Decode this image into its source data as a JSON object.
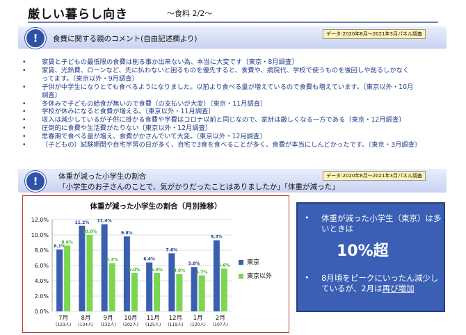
{
  "page": {
    "title": "厳しい暮らし向き",
    "subtitle": "～食料 2/2～"
  },
  "panel1": {
    "icon": "!",
    "title": "食費に関する親のコメント(自由記述欄より)",
    "source": "データ:2020年8月～2021年3月パネル調査",
    "bullet": "•",
    "comments": [
      "家賃と子どもの最低限の食費は削る事か出来ない為、本当に大変です〔東京・8月調査〕",
      "家賃、光熱費、ローンなど、先に払わないと困るものを優先すると、食費や、病院代、学校で使うものを後回しや削るしかなく",
      "ってます。〔東京以外・9月調査〕",
      "子供が中学生になりとても食べるようになりました。以前より食べる量が増えているので食費も増えています。〔東京以外・10月",
      "調査〕",
      "冬休みで子どもの給食が無いので食費（の支払いが大変）〔東京・11月調査〕",
      "学校が休みになると食費が増える。〔東京以外・11月調査〕",
      "収入は減少しているが子供に掛かる食費や学費はコロナ以前と同じなので、家計は厳しくなる一方である〔東京・12月調査〕",
      "圧倒的に食費や生活費がたりない〔東京以外・12月調査〕",
      "思春期で食べる量が増え、食費がかさんでいて大変。〔東京以外・12月調査〕",
      "（子どもの）試験期間や自宅学習の日が多く、自宅で3食を食べることが多く、食費が本当にしんどかったです。〔東京・3月調査〕"
    ]
  },
  "panel2": {
    "icon": "!",
    "title": "体重が減った小学生の割合",
    "question": "「小学生のお子さんのことで、気がかりだったことはありましたか」「体重が減った」",
    "source": "データ:2020年8月～2021年3月パネル調査"
  },
  "info": {
    "bullet": "•",
    "line1": "体重が減った小学生（東京）は多いときは",
    "big": "10%超",
    "line2_a": "8月頃をピークにいったん減少しているが、2月は",
    "line2_b": "再び増加"
  },
  "colors": {
    "tokyo": "#3b5fb0",
    "other": "#7bd650",
    "accent": "#2f52a8"
  },
  "chart_data": {
    "type": "bar",
    "title": "体重が減った小学生の割合（月別推移）",
    "categories": [
      "7月",
      "8月",
      "9月",
      "10月",
      "11月",
      "12月",
      "1月",
      "2月"
    ],
    "n_labels": [
      "(123人)",
      "(134人)",
      "(132人)",
      "(102人)",
      "(125人)",
      "(119人)",
      "(120人)",
      "(107人)"
    ],
    "series": [
      {
        "name": "東京",
        "values": [
          8.1,
          11.2,
          11.4,
          9.8,
          6.4,
          7.6,
          5.8,
          9.3
        ],
        "labels": [
          "8.1%",
          "11.2%",
          "11.4%",
          "9.8%",
          "6.4%",
          "7.6%",
          "5.8%",
          "9.3%"
        ]
      },
      {
        "name": "東京以外",
        "values": [
          8.6,
          10.0,
          6.3,
          5.0,
          5.0,
          4.9,
          4.7,
          5.6
        ],
        "labels": [
          "8.6%",
          "10.0%",
          "6.3%",
          "5.0%",
          "5.0%",
          "4.9%",
          "4.7%",
          "5.6%"
        ]
      }
    ],
    "ylim": [
      0,
      12
    ],
    "yticks": [
      0,
      2,
      4,
      6,
      8,
      10,
      12
    ],
    "ytick_labels": [
      "0.0%",
      "2.0%",
      "4.0%",
      "6.0%",
      "8.0%",
      "10.0%",
      "12.0%"
    ],
    "grid": true,
    "legend": "right"
  }
}
